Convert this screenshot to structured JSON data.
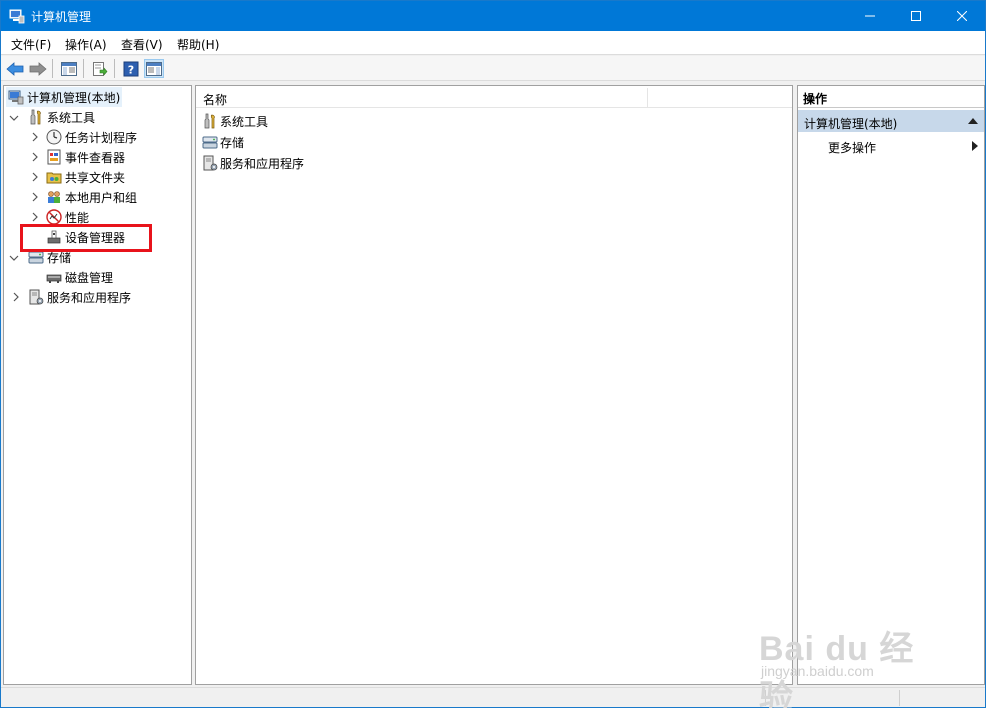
{
  "window": {
    "title": "计算机管理"
  },
  "menu": [
    "文件(F)",
    "操作(A)",
    "查看(V)",
    "帮助(H)"
  ],
  "tree": {
    "root": "计算机管理(本地)",
    "system_tools": "系统工具",
    "task_scheduler": "任务计划程序",
    "event_viewer": "事件查看器",
    "shared_folders": "共享文件夹",
    "local_users": "本地用户和组",
    "performance": "性能",
    "device_manager": "设备管理器",
    "storage": "存储",
    "disk_management": "磁盘管理",
    "services_apps": "服务和应用程序"
  },
  "list": {
    "column_name": "名称",
    "items": [
      "系统工具",
      "存储",
      "服务和应用程序"
    ]
  },
  "actions": {
    "header": "操作",
    "section": "计算机管理(本地)",
    "more": "更多操作"
  },
  "watermark": {
    "brand": "Bai du 经验",
    "url": "jingyan.baidu.com"
  },
  "colors": {
    "titlebar": "#0078d7",
    "selection": "#e5f1fb",
    "actions_section": "#c7d8ea",
    "highlight": "#e8131b"
  }
}
